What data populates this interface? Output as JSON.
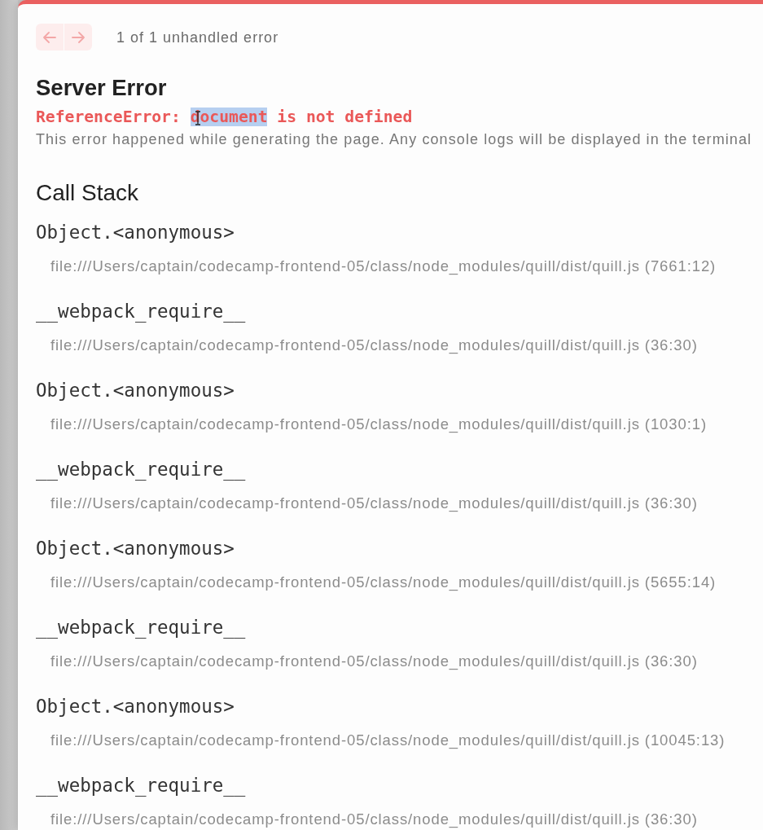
{
  "navigation": {
    "buttons": [
      {
        "kind": "previous",
        "disabled": true
      },
      {
        "kind": "next",
        "disabled": true
      }
    ],
    "counter": "1 of 1 unhandled error"
  },
  "error": {
    "title": "Server Error",
    "message": [
      {
        "text": "ReferenceError: ",
        "selected": false
      },
      {
        "text": "document",
        "selected": true
      },
      {
        "text": " is not defined",
        "selected": false
      }
    ],
    "description": "This error happened while generating the page. Any console logs will be displayed in the terminal"
  },
  "call_stack": {
    "title": "Call Stack",
    "frames": [
      {
        "function": "Object.<anonymous>",
        "location": "file:///Users/captain/codecamp-frontend-05/class/node_modules/quill/dist/quill.js (7661:12)"
      },
      {
        "function": "__webpack_require__",
        "location": "file:///Users/captain/codecamp-frontend-05/class/node_modules/quill/dist/quill.js (36:30)"
      },
      {
        "function": "Object.<anonymous>",
        "location": "file:///Users/captain/codecamp-frontend-05/class/node_modules/quill/dist/quill.js (1030:1)"
      },
      {
        "function": "__webpack_require__",
        "location": "file:///Users/captain/codecamp-frontend-05/class/node_modules/quill/dist/quill.js (36:30)"
      },
      {
        "function": "Object.<anonymous>",
        "location": "file:///Users/captain/codecamp-frontend-05/class/node_modules/quill/dist/quill.js (5655:14)"
      },
      {
        "function": "__webpack_require__",
        "location": "file:///Users/captain/codecamp-frontend-05/class/node_modules/quill/dist/quill.js (36:30)"
      },
      {
        "function": "Object.<anonymous>",
        "location": "file:///Users/captain/codecamp-frontend-05/class/node_modules/quill/dist/quill.js (10045:13)"
      },
      {
        "function": "__webpack_require__",
        "location": "file:///Users/captain/codecamp-frontend-05/class/node_modules/quill/dist/quill.js (36:30)"
      }
    ]
  }
}
